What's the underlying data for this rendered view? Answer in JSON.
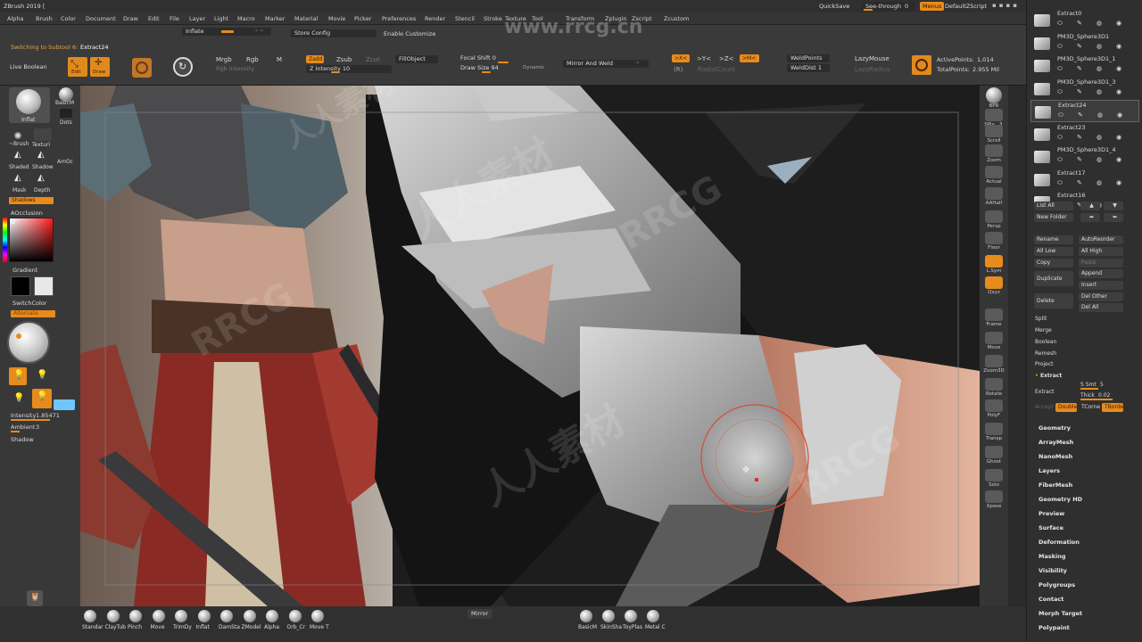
{
  "app": {
    "title": "ZBrush 2019 ["
  },
  "menubar": {
    "items": [
      "Alpha",
      "Brush",
      "Color",
      "Document",
      "Draw",
      "Edit",
      "File",
      "Layer",
      "Light",
      "Macro",
      "Marker",
      "Material",
      "Movie",
      "Picker",
      "Preferences",
      "Render",
      "Stencil",
      "Stroke",
      "Texture",
      "Tool",
      "Transform",
      "Zplugin",
      "Zscript",
      "Zcustom"
    ],
    "quicksave": "QuickSave",
    "see_through": "See-through",
    "see_through_value": "0",
    "menus": "Menus",
    "default_script": "DefaultZScript"
  },
  "topshelf": {
    "status": "Switching to Subtool 6:",
    "status_name": "Extract24",
    "live_boolean": "Live Boolean",
    "inflate": "Inflate",
    "store_config": "Store Config",
    "enable_customize": "Enable Customize",
    "edit": "Edit",
    "draw": "Draw",
    "mrgb": "Mrgb",
    "rgb": "Rgb",
    "m": "M",
    "rgb_intensity": "Rgb Intensity",
    "zadd": "Zadd",
    "zsub": "Zsub",
    "zcut": "Zcut",
    "z_intensity_label": "Z Intensity",
    "z_intensity_value": "10",
    "fill_object": "FillObject",
    "focal_shift_label": "Focal Shift",
    "focal_shift_value": "0",
    "draw_size_label": "Draw Size",
    "draw_size_value": "94",
    "dynamic": "Dynamic",
    "mirror_and_weld": "Mirror And Weld",
    "x": ">X<",
    "y": ">Y<",
    "z": ">Z<",
    "m_sym": ">M<",
    "r": "(R)",
    "radial_count": "RadialCount",
    "weld_points": "WeldPoints",
    "weld_dist_label": "WeldDist",
    "weld_dist_value": "1",
    "lazy_mouse": "LazyMouse",
    "lazy_radius": "LazyRadius",
    "active_points_label": "ActivePoints:",
    "active_points_value": "1,014",
    "total_points_label": "TotalPoints:",
    "total_points_value": "2.955 Mil"
  },
  "leftshelf": {
    "inflat": "Inflat",
    "basicm": "BasicM",
    "brush": "~Brush",
    "textur": "Texturi",
    "dots": "Dots",
    "shaded": "Shaded",
    "shadow": "Shadow",
    "amoc": "AmOc",
    "mask": "Mask",
    "depth": "Depth",
    "shadows": "Shadows",
    "aocclusion": "AOcclusion",
    "gradient": "Gradient",
    "switchcolor": "SwitchColor",
    "alternate": "Alternate",
    "intensity_label": "Intensity",
    "intensity_value": "1.85471",
    "ambient_label": "Ambient",
    "ambient_value": "3",
    "shadow_label": "Shadow"
  },
  "rightshelf": {
    "items": [
      "BPR",
      "SPix",
      "Scroll",
      "Zoom",
      "Actual",
      "AAHalf",
      "Persp",
      "Floor",
      "L.Sym",
      "Qxyz",
      "Frame",
      "Move",
      "Zoom3D",
      "Rotate",
      "PolyF",
      "Transp",
      "Ghost",
      "Solo",
      "Xpose"
    ],
    "spix_value": "3"
  },
  "subtool": {
    "items": [
      {
        "name": "Extract0"
      },
      {
        "name": "PM3D_Sphere3D1"
      },
      {
        "name": "PM3D_Sphere3D1_1"
      },
      {
        "name": "PM3D_Sphere3D1_3"
      },
      {
        "name": "Extract24"
      },
      {
        "name": "Extract23"
      },
      {
        "name": "PM3D_Sphere3D1_4"
      },
      {
        "name": "Extract17"
      },
      {
        "name": "Extract16"
      }
    ],
    "list_all": "List All",
    "new_folder": "New Folder",
    "rename": "Rename",
    "auto_reorder": "AutoReorder",
    "all_low": "All Low",
    "all_high": "All High",
    "copy": "Copy",
    "paste": "Paste",
    "duplicate": "Duplicate",
    "append": "Append",
    "insert": "Insert",
    "delete": "Delete",
    "del_other": "Del Other",
    "del_all": "Del All",
    "split": "Split",
    "merge": "Merge",
    "boolean": "Boolean",
    "remesh": "Remesh",
    "project": "Project",
    "extract_header": "Extract",
    "extract_btn": "Extract",
    "s_smt_label": "S Smt",
    "s_smt_value": "5",
    "thick_label": "Thick",
    "thick_value": "0.02",
    "accept": "Accept",
    "double": "Double",
    "tcorne": "TCorne",
    "tborder": "TBorde"
  },
  "tool_sections": [
    "Geometry",
    "ArrayMesh",
    "NanoMesh",
    "Layers",
    "FiberMesh",
    "Geometry HD",
    "Preview",
    "Surface",
    "Deformation",
    "Masking",
    "Visibility",
    "Polygroups",
    "Contact",
    "Morph Target",
    "Polypaint"
  ],
  "bottomshelf": {
    "brushes_left": [
      "Standar",
      "ClayTub",
      "Pinch",
      "Move",
      "TrimDy",
      "Inflat",
      "DamSta",
      "ZModel",
      "Alpha",
      "Orb_Cr",
      "Move T"
    ],
    "mirror": "Mirror",
    "brushes_right": [
      "BasicM",
      "SkinSha",
      "ToyPlas",
      "Metal C"
    ]
  },
  "watermark": {
    "text1": "人人素材",
    "text2": "RRCG",
    "url": "www.rrcg.cn"
  },
  "colors": {
    "accent": "#e78b1c",
    "panel": "#2f2f2f",
    "canvas": "#1d1d1d"
  }
}
